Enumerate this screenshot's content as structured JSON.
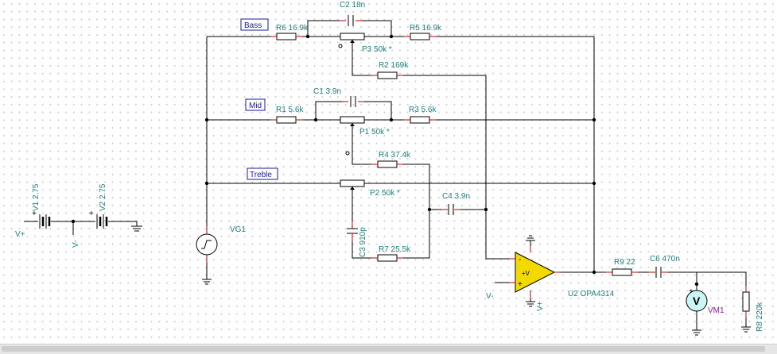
{
  "nets": {
    "bass": "Bass",
    "mid": "Mid",
    "treble": "Treble"
  },
  "components": {
    "r6": "R6 16.9k",
    "r5": "R5 16.9k",
    "r1": "R1 5.6k",
    "r3": "R3 5.6k",
    "r2": "R2 169k",
    "r4": "R4 37.4k",
    "r7": "R7 25.5k",
    "r9": "R9 22",
    "r8": "R8 220k",
    "c2": "C2 18n",
    "c1": "C1 3.9n",
    "c4": "C4 3.9n",
    "c3": "C3 910p",
    "c6": "C6 470n",
    "p3": "P3 50k *",
    "p1": "P1 50k *",
    "p2": "P2 50k *",
    "vg1": "VG1",
    "v1": "V1 2.75",
    "v2": "V2 2.75",
    "u2": "U2 OPA4314",
    "vm1": "VM1"
  },
  "terminals": {
    "vplus": "V+",
    "vminus": "V-"
  },
  "symbols": {
    "opamp_plus": "+",
    "opamp_minus": "-",
    "opamp_supply": "+V",
    "meter": "V"
  },
  "colors": {
    "wire": "#000000",
    "pin": "#c00000",
    "label": "#1f8080",
    "net_label": "#1a1aa0",
    "meter_label": "#8b1a8b",
    "opamp_fill": "#f2d900",
    "meter_fill": "#ccf5f5"
  }
}
